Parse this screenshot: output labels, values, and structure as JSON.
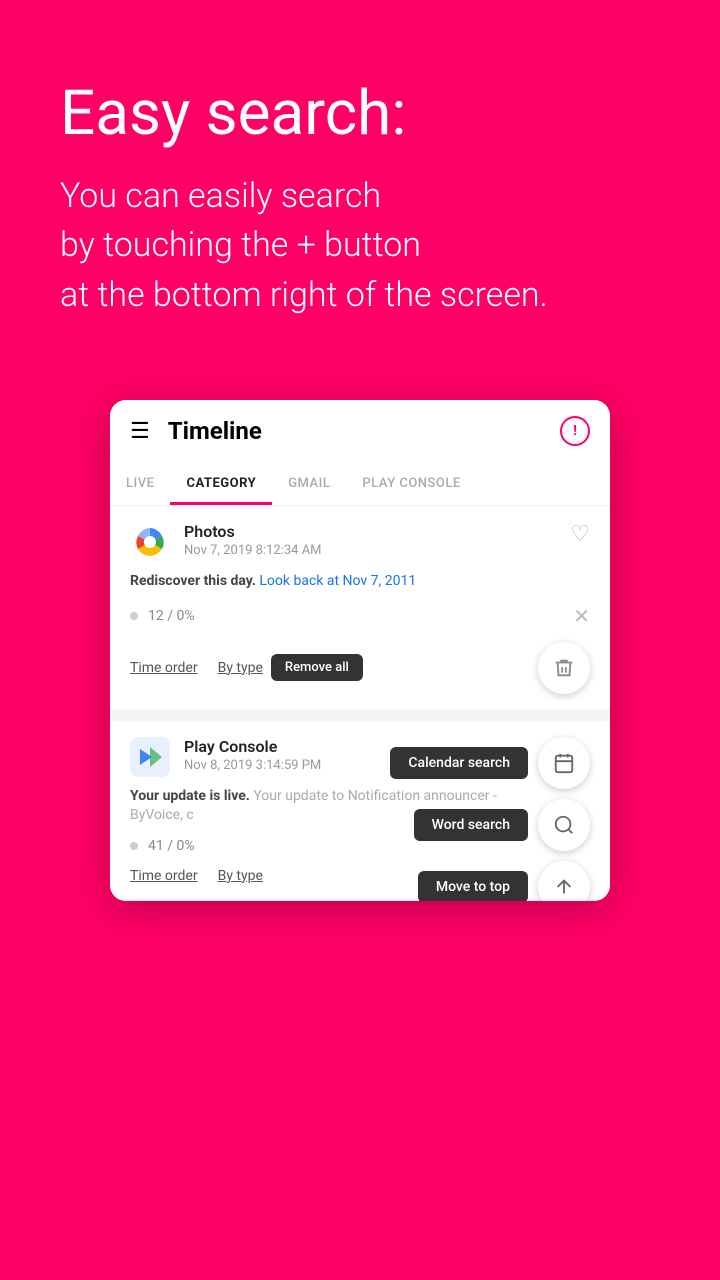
{
  "hero": {
    "title": "Easy search:",
    "description": "You can easily search\nby touching the + button\nat the bottom right of the screen."
  },
  "app": {
    "title": "Timeline",
    "tabs": [
      {
        "id": "live",
        "label": "LIVE",
        "active": false
      },
      {
        "id": "category",
        "label": "CATEGORY",
        "active": true
      },
      {
        "id": "gmail",
        "label": "GMAIL",
        "active": false
      },
      {
        "id": "play_console",
        "label": "PLAY CONSOLE",
        "active": false
      }
    ]
  },
  "cards": [
    {
      "id": "photos",
      "app_name": "Photos",
      "timestamp": "Nov 7, 2019 8:12:34 AM",
      "body_text": "Rediscover this day.",
      "body_link": "Look back at Nov 7, 2011",
      "stats": "12 / 0%",
      "filters": {
        "time_order": "Time order",
        "by_type": "By type",
        "remove_all": "Remove all"
      }
    },
    {
      "id": "play_console",
      "app_name": "Play Console",
      "timestamp": "Nov 8, 2019 3:14:59 PM",
      "body_text": "Your update is live.",
      "body_secondary": "Your update to Notification announcer - ByVoice, c",
      "stats": "41 / 0%",
      "filters": {
        "time_order": "Time order",
        "by_type": "By type"
      }
    }
  ],
  "tooltips": {
    "calendar_search": "Calendar search",
    "word_search": "Word search",
    "move_to_top": "Move to top"
  },
  "colors": {
    "brand": "#FF0066",
    "tab_active_underline": "#FF0066",
    "text_dark": "#222222",
    "text_muted": "#999999"
  }
}
